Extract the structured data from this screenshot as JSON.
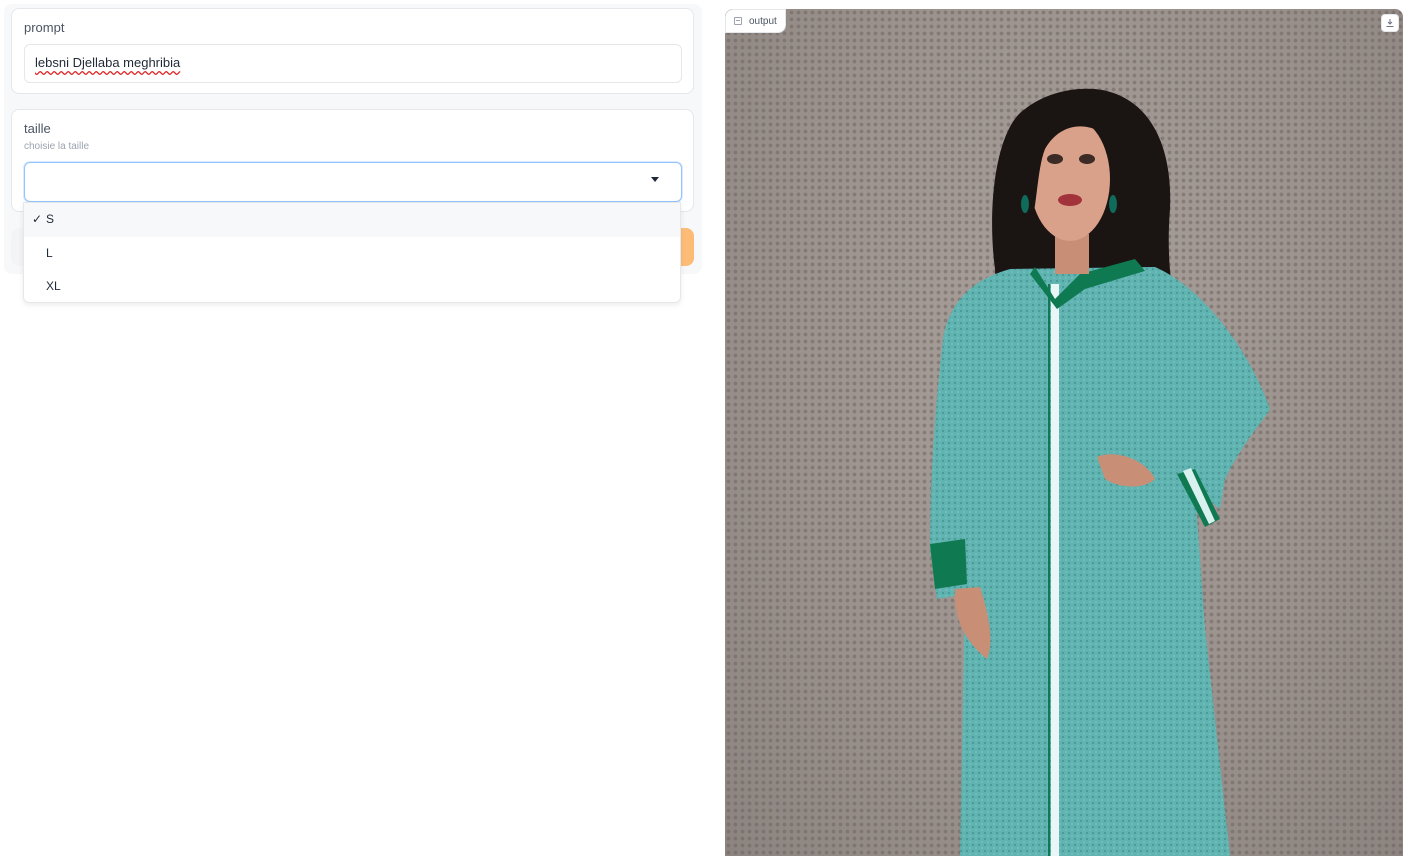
{
  "prompt_block": {
    "label": "prompt",
    "value": "lebsni Djellaba meghribia"
  },
  "taille_block": {
    "label": "taille",
    "info": "choisie la taille",
    "selected_value": "",
    "options": [
      {
        "label": "S",
        "checked": true
      },
      {
        "label": "L",
        "checked": false
      },
      {
        "label": "XL",
        "checked": false
      }
    ],
    "check_mark": "✓"
  },
  "output_panel": {
    "label": "output",
    "label_icon": "image-icon",
    "download_icon": "download-icon"
  },
  "colors": {
    "accent_orange": "#fdba74",
    "focus_blue": "#93c5fd",
    "djellaba_teal": "#5fb3b0",
    "trim_green": "#0f7a52"
  }
}
